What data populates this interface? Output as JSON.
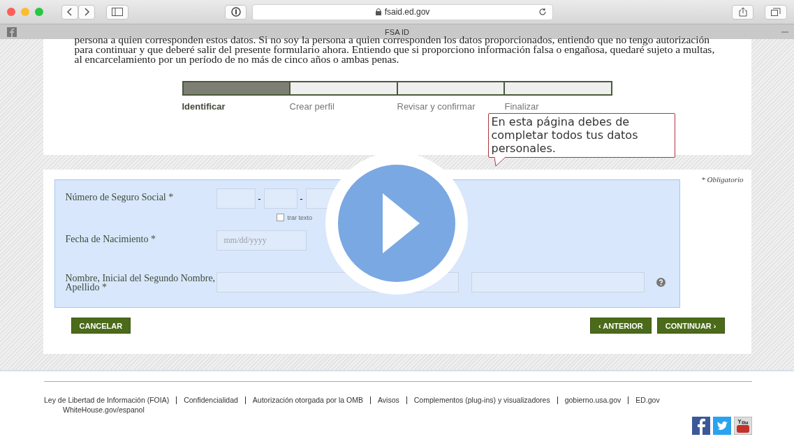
{
  "browser": {
    "url": "fsaid.ed.gov",
    "tab_title": "FSA ID"
  },
  "intro_text": "persona a quien corresponden estos datos. Si no soy la persona a quien corresponden los datos proporcionados, entiendo que no tengo autorización para continuar y que deberé salir del presente formulario ahora. Entiendo que si proporciono información falsa o engañosa, quedaré sujeto a multas, al encarcelamiento por un período de no más de cinco años o ambas penas.",
  "steps": [
    {
      "label": "Identificar",
      "selected": true
    },
    {
      "label": "Crear perfil",
      "selected": false
    },
    {
      "label": "Revisar y confirmar",
      "selected": false
    },
    {
      "label": "Finalizar",
      "selected": false
    }
  ],
  "tooltip": "En esta página debes de completar todos tus datos personales.",
  "required_note": "* Obligatorio",
  "form": {
    "ssn": {
      "label": "Número de Seguro Social *",
      "separators": [
        "-",
        "-"
      ],
      "show_text": {
        "label": "trar texto",
        "checked": false
      }
    },
    "dob": {
      "label": "Fecha de Nacimiento *",
      "placeholder": "mm/dd/yyyy"
    },
    "name": {
      "label": "Nombre, Inicial del Segundo Nombre, Apellido *"
    }
  },
  "buttons": {
    "cancel": "CANCELAR",
    "back": "‹ ANTERIOR",
    "next": "CONTINUAR ›"
  },
  "footer_links": [
    "Ley de Libertad de Información (FOIA)",
    "Confidencialidad",
    "Autorización otorgada por la OMB",
    "Avisos",
    "Complementos (plug-ins) y visualizadores",
    "gobierno.usa.gov",
    "ED.gov",
    "WhiteHouse.gov/espanol"
  ]
}
